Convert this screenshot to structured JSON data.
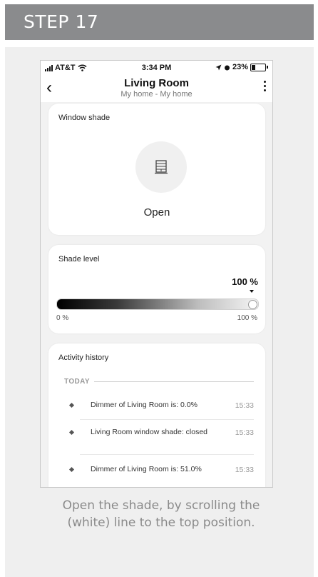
{
  "step": {
    "label": "STEP 17"
  },
  "status_bar": {
    "carrier": "AT&T",
    "time": "3:34 PM",
    "battery": "23%"
  },
  "nav": {
    "title": "Living Room",
    "subtitle": "My home - My home"
  },
  "window_shade": {
    "title": "Window shade",
    "state": "Open",
    "icon": "window-shade-icon"
  },
  "shade_level": {
    "title": "Shade level",
    "value_label": "100 %",
    "value": 100,
    "min_label": "0 %",
    "max_label": "100 %"
  },
  "activity": {
    "title": "Activity history",
    "group": "TODAY",
    "events": [
      {
        "text": "Dimmer of Living Room is: 0.0%",
        "time": "15:33"
      },
      {
        "text": "Living Room window shade: closed",
        "time": "15:33"
      },
      {
        "text": "Dimmer of Living Room is: 51.0%",
        "time": "15:33"
      }
    ]
  },
  "caption": "Open the shade, by scrolling the (white) line to the top position.",
  "colors": {
    "header_bg": "#8a8b8d",
    "card_bg": "#efefef",
    "caption": "#8a8a8a"
  }
}
